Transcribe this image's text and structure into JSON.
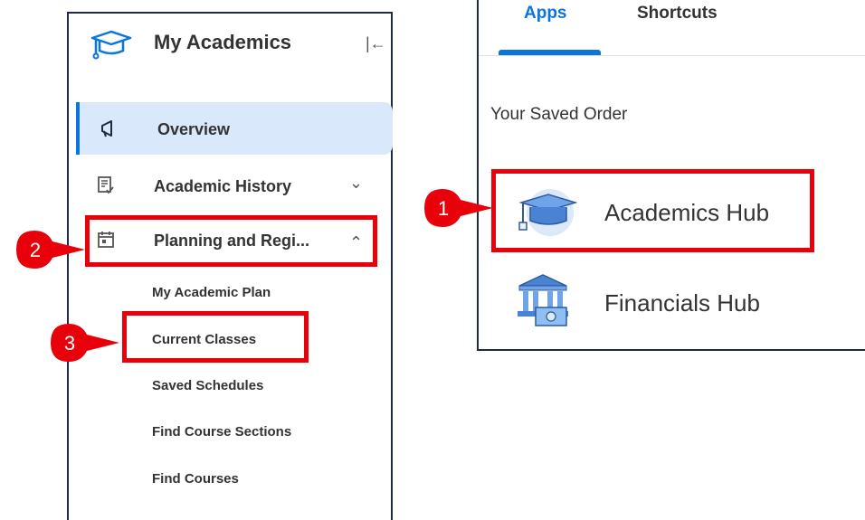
{
  "sidebar": {
    "title": "My Academics",
    "collapse_icon": "collapse-left-icon",
    "items": [
      {
        "label": "Overview",
        "icon": "megaphone-icon",
        "active": true
      },
      {
        "label": "Academic History",
        "icon": "document-check-icon",
        "expanded": false
      },
      {
        "label": "Planning and Regi...",
        "icon": "calendar-icon",
        "expanded": true
      }
    ],
    "subitems": [
      "My Academic Plan",
      "Current Classes",
      "Saved Schedules",
      "Find Course Sections",
      "Find Courses"
    ]
  },
  "apps_panel": {
    "tabs": [
      {
        "label": "Apps",
        "active": true
      },
      {
        "label": "Shortcuts",
        "active": false
      }
    ],
    "section_heading": "Your Saved Order",
    "apps": [
      {
        "label": "Academics Hub",
        "icon": "graduation-cap-icon"
      },
      {
        "label": "Financials Hub",
        "icon": "bank-icon"
      }
    ]
  },
  "callouts": [
    "1",
    "2",
    "3"
  ],
  "colors": {
    "accent": "#0875e1",
    "highlight": "#e8000b",
    "active_bg": "#d9e8fb"
  }
}
